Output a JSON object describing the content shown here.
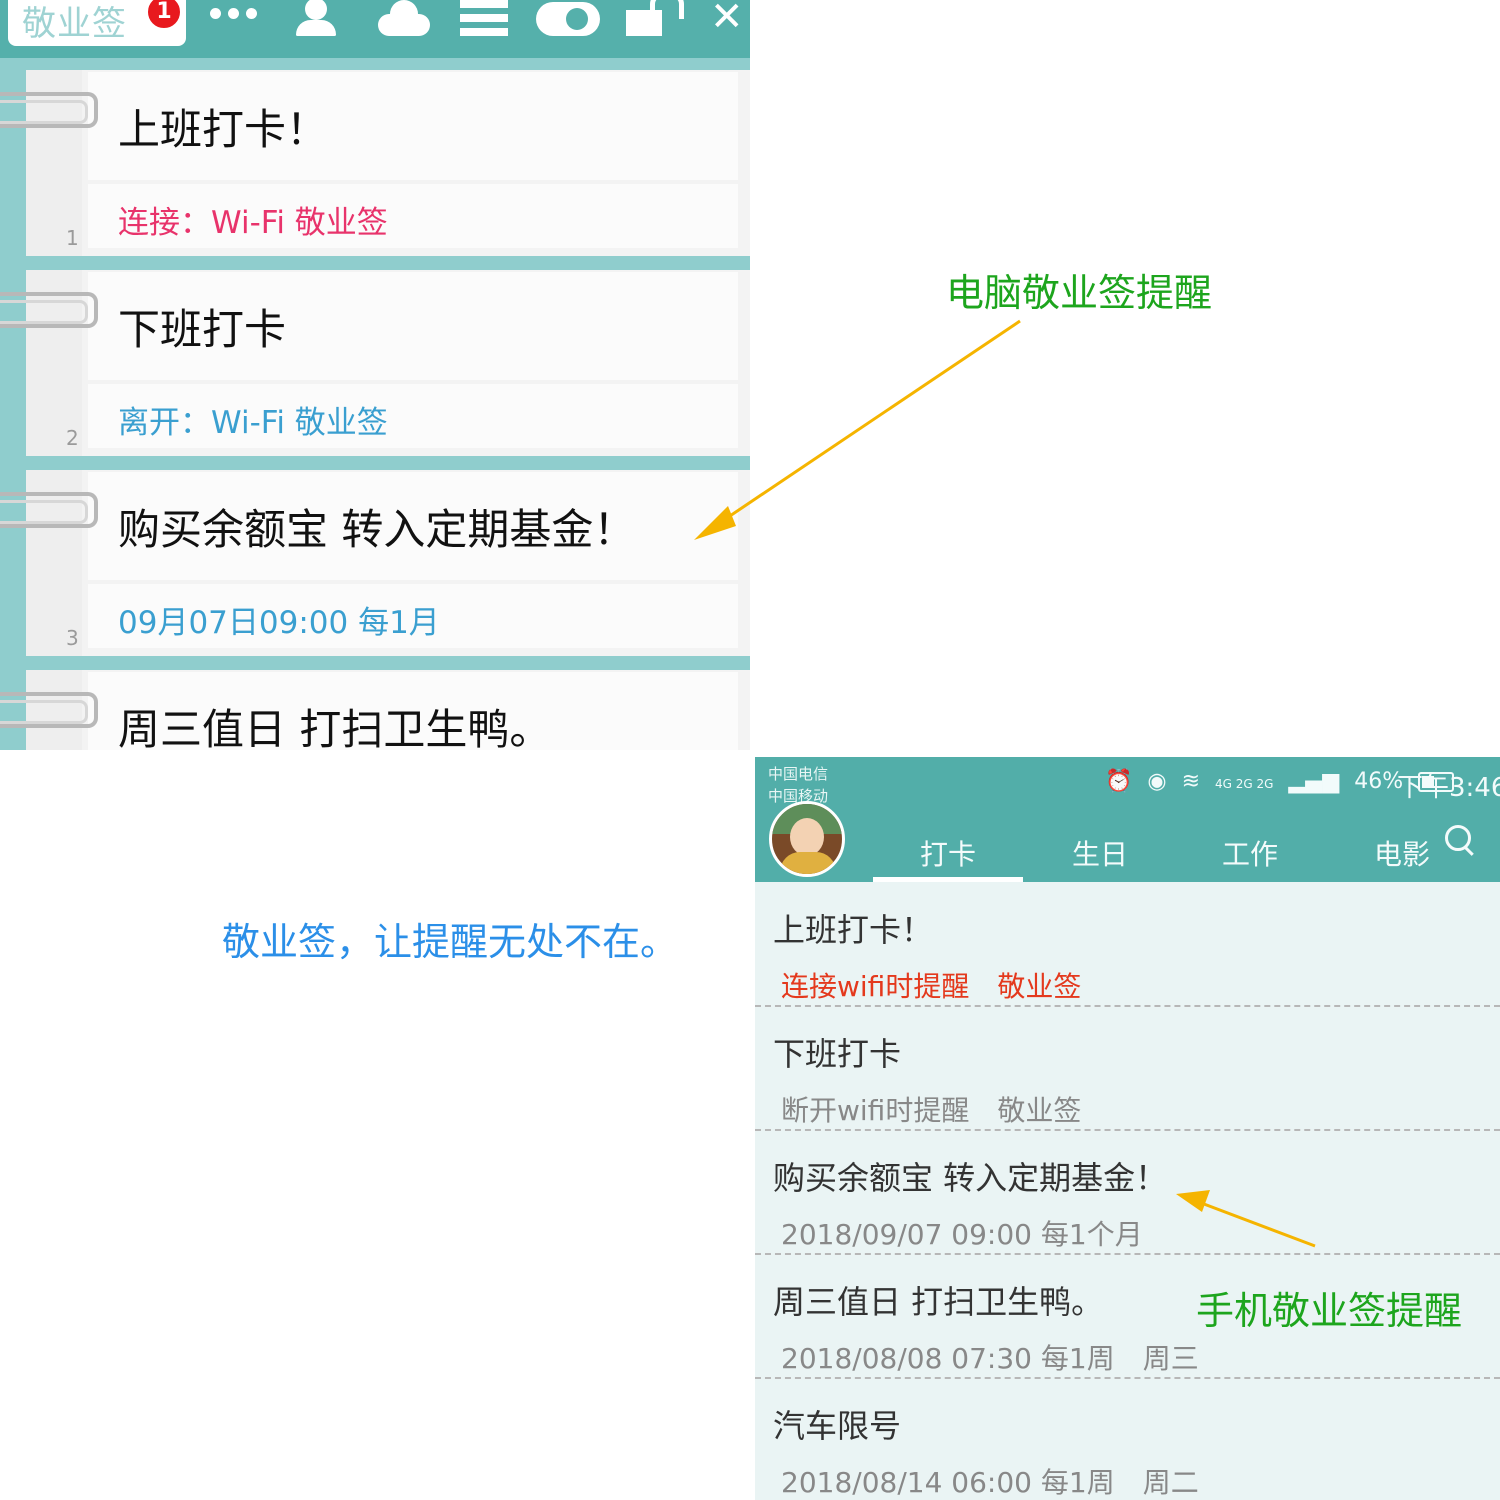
{
  "desktop": {
    "app_name": "敬业签",
    "badge_count": "1",
    "close_glyph": "✕",
    "toolbar_icons": [
      "more-icon",
      "user-icon",
      "cloud-icon",
      "list-icon",
      "toggle-icon",
      "lock-icon",
      "close-icon"
    ],
    "notes": [
      {
        "title": "上班打卡！",
        "detail": "连接：Wi-Fi 敬业签",
        "detail_color": "#e8336b",
        "index": "1"
      },
      {
        "title": "下班打卡",
        "detail": "离开：Wi-Fi 敬业签",
        "detail_color": "#3a9fd0",
        "index": "2"
      },
      {
        "title": "购买余额宝 转入定期基金！",
        "detail": "09月07日09:00 每1月",
        "detail_color": "#3a9fd0",
        "index": "3"
      },
      {
        "title": "周三值日 打扫卫生鸭。",
        "detail": "",
        "detail_color": "#3a9fd0",
        "index": ""
      }
    ]
  },
  "captions": {
    "pc": "电脑敬业签提醒",
    "slogan": "敬业签，让提醒无处不在。",
    "phone": "手机敬业签提醒"
  },
  "phone": {
    "status": {
      "carrier_1": "中国电信",
      "carrier_2": "中国移动",
      "signal_text": "4G 2G 2G",
      "battery": "46%",
      "time": "下午3:46"
    },
    "tabs": [
      "打卡",
      "生日",
      "工作",
      "电影"
    ],
    "active_tab": "打卡",
    "items": [
      {
        "title": "上班打卡！",
        "meta": "连接wifi时提醒　敬业签",
        "meta_color": "#e4391d"
      },
      {
        "title": "下班打卡",
        "meta": "断开wifi时提醒　敬业签",
        "meta_color": "#8a8a8a"
      },
      {
        "title": "购买余额宝 转入定期基金！",
        "meta": "2018/09/07 09:00 每1个月",
        "meta_color": "#8a8a8a"
      },
      {
        "title": "周三值日 打扫卫生鸭。",
        "meta": "2018/08/08 07:30 每1周　周三",
        "meta_color": "#8a8a8a"
      },
      {
        "title": "汽车限号",
        "meta": "2018/08/14 06:00 每1周　周二",
        "meta_color": "#8a8a8a"
      }
    ]
  },
  "colors": {
    "teal": "#52aea9",
    "caption_green": "#1da51d",
    "slogan_blue": "#2b8fe8",
    "arrow_orange": "#f5b400"
  }
}
